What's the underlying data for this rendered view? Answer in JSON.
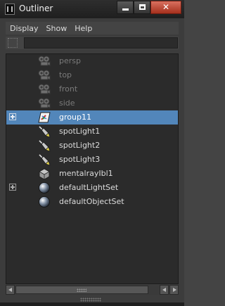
{
  "window": {
    "title": "Outliner",
    "close_glyph": "✕"
  },
  "menu": {
    "items": [
      "Display",
      "Show",
      "Help"
    ]
  },
  "filter": {
    "value": "",
    "icon": "filter-icon"
  },
  "outliner": {
    "items": [
      {
        "label": "persp",
        "icon": "camera-icon",
        "dimmed": true,
        "expandable": false,
        "selected": false
      },
      {
        "label": "top",
        "icon": "camera-icon",
        "dimmed": true,
        "expandable": false,
        "selected": false
      },
      {
        "label": "front",
        "icon": "camera-icon",
        "dimmed": true,
        "expandable": false,
        "selected": false
      },
      {
        "label": "side",
        "icon": "camera-icon",
        "dimmed": true,
        "expandable": false,
        "selected": false
      },
      {
        "label": "group11",
        "icon": "group-icon",
        "dimmed": false,
        "expandable": true,
        "selected": true
      },
      {
        "label": "spotLight1",
        "icon": "spotlight-icon",
        "dimmed": false,
        "expandable": false,
        "selected": false
      },
      {
        "label": "spotLight2",
        "icon": "spotlight-icon",
        "dimmed": false,
        "expandable": false,
        "selected": false
      },
      {
        "label": "spotLight3",
        "icon": "spotlight-icon",
        "dimmed": false,
        "expandable": false,
        "selected": false
      },
      {
        "label": "mentalrayIbl1",
        "icon": "ibl-icon",
        "dimmed": false,
        "expandable": false,
        "selected": false
      },
      {
        "label": "defaultLightSet",
        "icon": "set-icon",
        "dimmed": false,
        "expandable": true,
        "selected": false
      },
      {
        "label": "defaultObjectSet",
        "icon": "set-icon",
        "dimmed": false,
        "expandable": false,
        "selected": false
      }
    ]
  },
  "colors": {
    "selection": "#5286ba",
    "panel": "#2b2b2b",
    "text": "#dcdcdc",
    "dim_text": "#7a7a7a"
  }
}
